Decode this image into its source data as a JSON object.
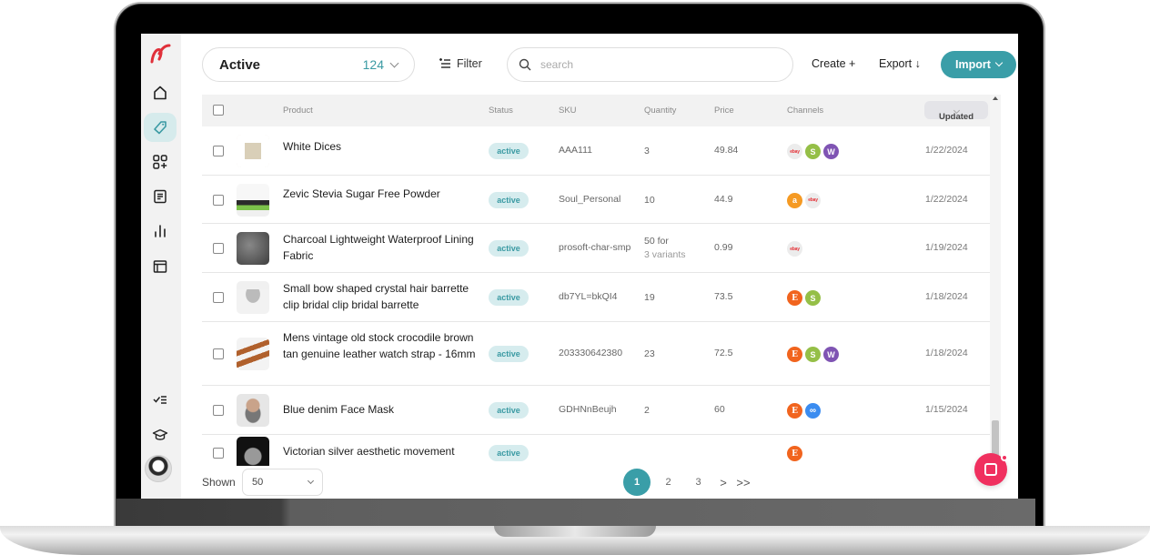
{
  "topbar": {
    "status_filter": {
      "label": "Active",
      "count": "124"
    },
    "filter_label": "Filter",
    "search_placeholder": "search",
    "search_value": "",
    "create_label": "Create +",
    "export_label": "Export ↓",
    "import_label": "Import"
  },
  "sidebar": {
    "items": [
      {
        "name": "home",
        "icon": "home-icon",
        "active": false
      },
      {
        "name": "products",
        "icon": "tag-icon",
        "active": true
      },
      {
        "name": "apps",
        "icon": "apps-add-icon",
        "active": false
      },
      {
        "name": "orders",
        "icon": "document-icon",
        "active": false
      },
      {
        "name": "analytics",
        "icon": "bar-chart-icon",
        "active": false
      },
      {
        "name": "layout",
        "icon": "layout-icon",
        "active": false
      },
      {
        "name": "tasks",
        "icon": "checklist-icon",
        "active": false
      },
      {
        "name": "learn",
        "icon": "graduation-cap-icon",
        "active": false
      }
    ]
  },
  "table": {
    "columns": [
      "Product",
      "Status",
      "SKU",
      "Quantity",
      "Price",
      "Channels",
      "Updated"
    ],
    "sort_column": "Updated",
    "rows": [
      {
        "product": "White Dices",
        "status": "active",
        "sku": "AAA111",
        "quantity": "3",
        "quantity_sub": "",
        "price": "49.84",
        "channels": [
          "ebay",
          "shopify",
          "woocommerce"
        ],
        "updated": "1/22/2024"
      },
      {
        "product": "Zevic Stevia Sugar Free Powder",
        "status": "active",
        "sku": "Soul_Personal",
        "quantity": "10",
        "quantity_sub": "",
        "price": "44.9",
        "channels": [
          "amazon",
          "ebay"
        ],
        "updated": "1/22/2024"
      },
      {
        "product": "Charcoal Lightweight Waterproof Lining Fabric",
        "status": "active",
        "sku": "prosoft-char-smp",
        "quantity": "50 for",
        "quantity_sub": "3 variants",
        "price": "0.99",
        "channels": [
          "ebay"
        ],
        "updated": "1/19/2024"
      },
      {
        "product": "Small bow shaped crystal hair barrette clip bridal clip bridal barrette",
        "status": "active",
        "sku": "db7YL=bkQI4",
        "quantity": "19",
        "quantity_sub": "",
        "price": "73.5",
        "channels": [
          "etsy",
          "shopify"
        ],
        "updated": "1/18/2024"
      },
      {
        "product": "Mens vintage old stock crocodile brown tan genuine leather watch strap - 16mm",
        "status": "active",
        "sku": "203330642380",
        "quantity": "23",
        "quantity_sub": "",
        "price": "72.5",
        "channels": [
          "etsy",
          "shopify",
          "woocommerce"
        ],
        "updated": "1/18/2024"
      },
      {
        "product": "Blue denim Face Mask",
        "status": "active",
        "sku": "GDHNnBeujh",
        "quantity": "2",
        "quantity_sub": "",
        "price": "60",
        "channels": [
          "etsy",
          "meta"
        ],
        "updated": "1/15/2024"
      },
      {
        "product": "Victorian silver aesthetic movement",
        "status": "active",
        "sku": "",
        "quantity": "",
        "quantity_sub": "",
        "price": "",
        "channels": [
          "etsy"
        ],
        "updated": ""
      }
    ]
  },
  "footer": {
    "shown_label": "Shown",
    "shown_value": "50",
    "pages": [
      "1",
      "2",
      "3"
    ],
    "current_page": "1",
    "next_label": ">",
    "last_label": ">>"
  },
  "channel_glyphs": {
    "ebay": "ebay",
    "shopify": "S",
    "woocommerce": "W",
    "amazon": "a",
    "etsy": "E",
    "meta": "∞"
  },
  "colors": {
    "accent": "#3a9ea8",
    "badge_bg": "#d6ecee",
    "chat": "#f0305f",
    "brand_logo": "#e0303a"
  }
}
